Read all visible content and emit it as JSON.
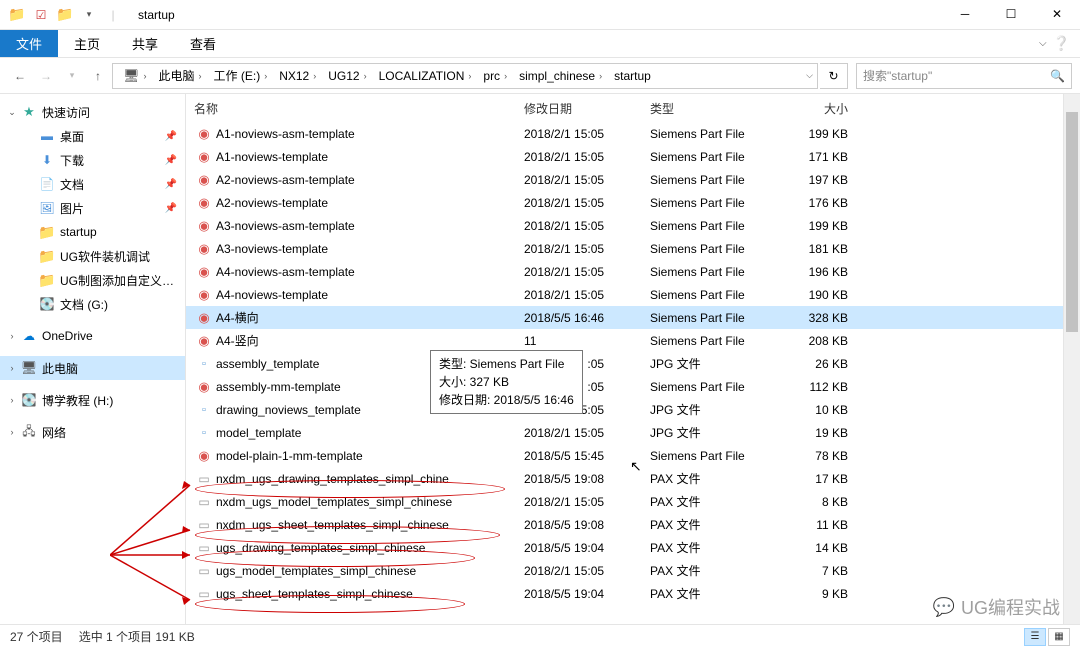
{
  "title": "startup",
  "ribbon": {
    "file": "文件",
    "home": "主页",
    "share": "共享",
    "view": "查看"
  },
  "breadcrumb": [
    "此电脑",
    "工作 (E:)",
    "NX12",
    "UG12",
    "LOCALIZATION",
    "prc",
    "simpl_chinese",
    "startup"
  ],
  "search": {
    "placeholder": "搜索\"startup\""
  },
  "sidebar": {
    "quick": "快速访问",
    "desktop": "桌面",
    "downloads": "下载",
    "documents": "文档",
    "pictures": "图片",
    "startup": "startup",
    "ug1": "UG软件装机调试",
    "ug2": "UG制图添加自定义…",
    "docdrive": "文档 (G:)",
    "onedrive": "OneDrive",
    "thispc": "此电脑",
    "hdrive": "博学教程 (H:)",
    "network": "网络"
  },
  "columns": {
    "name": "名称",
    "date": "修改日期",
    "type": "类型",
    "size": "大小"
  },
  "files": [
    {
      "icon": "prt",
      "name": "A1-noviews-asm-template",
      "date": "2018/2/1 15:05",
      "type": "Siemens Part File",
      "size": "199 KB"
    },
    {
      "icon": "prt",
      "name": "A1-noviews-template",
      "date": "2018/2/1 15:05",
      "type": "Siemens Part File",
      "size": "171 KB"
    },
    {
      "icon": "prt",
      "name": "A2-noviews-asm-template",
      "date": "2018/2/1 15:05",
      "type": "Siemens Part File",
      "size": "197 KB"
    },
    {
      "icon": "prt",
      "name": "A2-noviews-template",
      "date": "2018/2/1 15:05",
      "type": "Siemens Part File",
      "size": "176 KB"
    },
    {
      "icon": "prt",
      "name": "A3-noviews-asm-template",
      "date": "2018/2/1 15:05",
      "type": "Siemens Part File",
      "size": "199 KB"
    },
    {
      "icon": "prt",
      "name": "A3-noviews-template",
      "date": "2018/2/1 15:05",
      "type": "Siemens Part File",
      "size": "181 KB"
    },
    {
      "icon": "prt",
      "name": "A4-noviews-asm-template",
      "date": "2018/2/1 15:05",
      "type": "Siemens Part File",
      "size": "196 KB"
    },
    {
      "icon": "prt",
      "name": "A4-noviews-template",
      "date": "2018/2/1 15:05",
      "type": "Siemens Part File",
      "size": "190 KB"
    },
    {
      "icon": "prt",
      "name": "A4-横向",
      "date": "2018/5/5 16:46",
      "type": "Siemens Part File",
      "size": "328 KB",
      "sel": true
    },
    {
      "icon": "prt",
      "name": "A4-竖向",
      "date": "",
      "type": "Siemens Part File",
      "size": "208 KB"
    },
    {
      "icon": "jpg",
      "name": "assembly_template",
      "date": "",
      "type": "JPG 文件",
      "size": "26 KB"
    },
    {
      "icon": "prt",
      "name": "assembly-mm-template",
      "date": "",
      "type": "Siemens Part File",
      "size": "112 KB"
    },
    {
      "icon": "jpg",
      "name": "drawing_noviews_template",
      "date": "2018/2/1 15:05",
      "type": "JPG 文件",
      "size": "10 KB"
    },
    {
      "icon": "jpg",
      "name": "model_template",
      "date": "2018/2/1 15:05",
      "type": "JPG 文件",
      "size": "19 KB"
    },
    {
      "icon": "prt",
      "name": "model-plain-1-mm-template",
      "date": "2018/5/5 15:45",
      "type": "Siemens Part File",
      "size": "78 KB"
    },
    {
      "icon": "pax",
      "name": "nxdm_ugs_drawing_templates_simpl_chine",
      "date": "2018/5/5 19:08",
      "type": "PAX 文件",
      "size": "17 KB"
    },
    {
      "icon": "pax",
      "name": "nxdm_ugs_model_templates_simpl_chinese",
      "date": "2018/2/1 15:05",
      "type": "PAX 文件",
      "size": "8 KB"
    },
    {
      "icon": "pax",
      "name": "nxdm_ugs_sheet_templates_simpl_chinese",
      "date": "2018/5/5 19:08",
      "type": "PAX 文件",
      "size": "11 KB"
    },
    {
      "icon": "pax",
      "name": "ugs_drawing_templates_simpl_chinese",
      "date": "2018/5/5 19:04",
      "type": "PAX 文件",
      "size": "14 KB"
    },
    {
      "icon": "pax",
      "name": "ugs_model_templates_simpl_chinese",
      "date": "2018/2/1 15:05",
      "type": "PAX 文件",
      "size": "7 KB"
    },
    {
      "icon": "pax",
      "name": "ugs_sheet_templates_simpl_chinese",
      "date": "2018/5/5 19:04",
      "type": "PAX 文件",
      "size": "9 KB"
    }
  ],
  "partial_dates": {
    "9": "11",
    "10": ":05",
    "11": ":05"
  },
  "tooltip": {
    "l1": "类型: Siemens Part File",
    "l2": "大小: 327 KB",
    "l3": "修改日期: 2018/5/5 16:46"
  },
  "status": {
    "count": "27 个项目",
    "sel": "选中 1 个项目 191 KB"
  },
  "watermark": "UG编程实战"
}
